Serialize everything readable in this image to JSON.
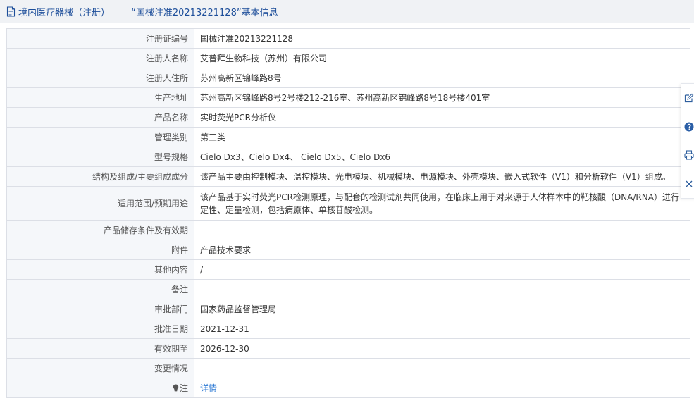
{
  "header": {
    "title": "境内医疗器械（注册） ——“国械注准20213221128”基本信息"
  },
  "rows": [
    {
      "label": "注册证编号",
      "value": "国械注准20213221128"
    },
    {
      "label": "注册人名称",
      "value": "艾普拜生物科技（苏州）有限公司"
    },
    {
      "label": "注册人住所",
      "value": "苏州高新区锦峰路8号"
    },
    {
      "label": "生产地址",
      "value": "苏州高新区锦峰路8号2号楼212-216室、苏州高新区锦峰路8号18号楼401室"
    },
    {
      "label": "产品名称",
      "value": "实时荧光PCR分析仪"
    },
    {
      "label": "管理类别",
      "value": "第三类"
    },
    {
      "label": "型号规格",
      "value": "Cielo Dx3、Cielo Dx4、 Cielo Dx5、Cielo Dx6"
    },
    {
      "label": "结构及组成/主要组成成分",
      "value": "该产品主要由控制模块、温控模块、光电模块、机械模块、电源模块、外壳模块、嵌入式软件（V1）和分析软件（V1）组成。"
    },
    {
      "label": "适用范围/预期用途",
      "value": "该产品基于实时荧光PCR检测原理，与配套的检测试剂共同使用，在临床上用于对来源于人体样本中的靶核酸（DNA/RNA）进行定性、定量检测，包括病原体、单核苷酸检测。"
    },
    {
      "label": "产品储存条件及有效期",
      "value": ""
    },
    {
      "label": "附件",
      "value": "产品技术要求"
    },
    {
      "label": "其他内容",
      "value": "/"
    },
    {
      "label": "备注",
      "value": ""
    },
    {
      "label": "审批部门",
      "value": "国家药品监督管理局"
    },
    {
      "label": "批准日期",
      "value": "2021-12-31"
    },
    {
      "label": "有效期至",
      "value": "2026-12-30"
    },
    {
      "label": "变更情况",
      "value": ""
    },
    {
      "label": "注",
      "value": "详情"
    }
  ],
  "icons": {
    "header": "document-icon",
    "note": "lightbulb-icon",
    "toolbar": [
      "edit-icon",
      "help-icon",
      "print-icon",
      "close-icon"
    ]
  },
  "colors": {
    "header_text": "#1d4e9a",
    "link": "#2f7bd4",
    "label_bg": "#f5f7fa",
    "border": "#dcdfe6"
  }
}
